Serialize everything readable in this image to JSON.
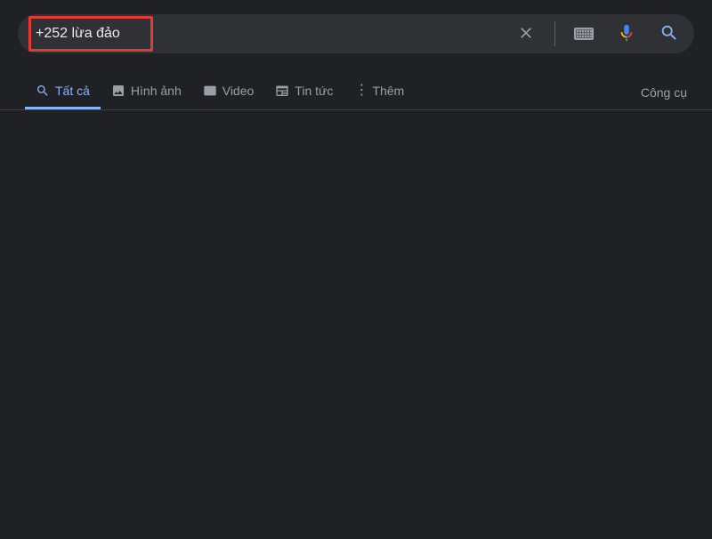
{
  "search": {
    "query": "+252 lừa đảo"
  },
  "tabs": {
    "all": "Tất cả",
    "images": "Hình ảnh",
    "video": "Video",
    "news": "Tin tức",
    "more": "Thêm"
  },
  "tools": "Công cụ"
}
